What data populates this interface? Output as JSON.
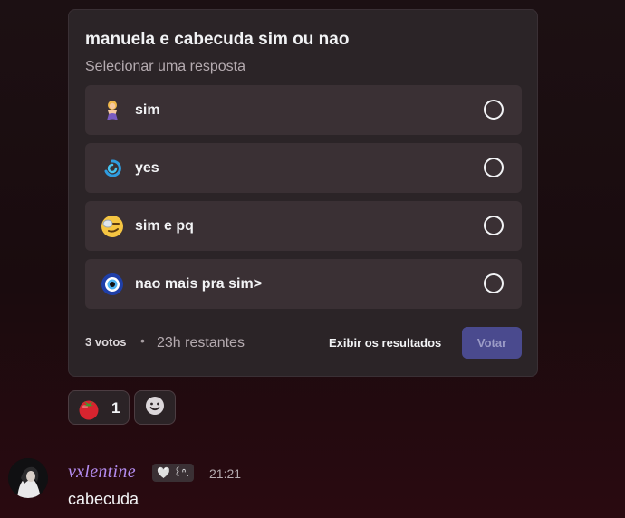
{
  "poll": {
    "question": "manuela e cabecuda sim ou nao",
    "subtitle": "Selecionar uma resposta",
    "answers": [
      {
        "emoji": "mermaid-emoji",
        "label": "sim"
      },
      {
        "emoji": "swirl-logo-emoji",
        "label": "yes"
      },
      {
        "emoji": "smirk-cool-emoji",
        "label": "sim e pq"
      },
      {
        "emoji": "nazar-eye-emoji",
        "label": "nao mais pra sim>"
      }
    ],
    "votes": "3 votos",
    "separator": "•",
    "remaining": "23h restantes",
    "show_results_label": "Exibir os resultados",
    "vote_label": "Votar"
  },
  "reactions": [
    {
      "emoji": "tomato-emoji",
      "count": "1"
    }
  ],
  "add_reaction_icon": "smiley-add-icon",
  "message": {
    "username": "vxlentine",
    "tag": "🤍 ꒰ᐢ.",
    "timestamp": "21:21",
    "text": "cabecuda"
  },
  "colors": {
    "accent": "#4a4a8e",
    "username": "#b48cf0",
    "panel": "#2b2427"
  }
}
